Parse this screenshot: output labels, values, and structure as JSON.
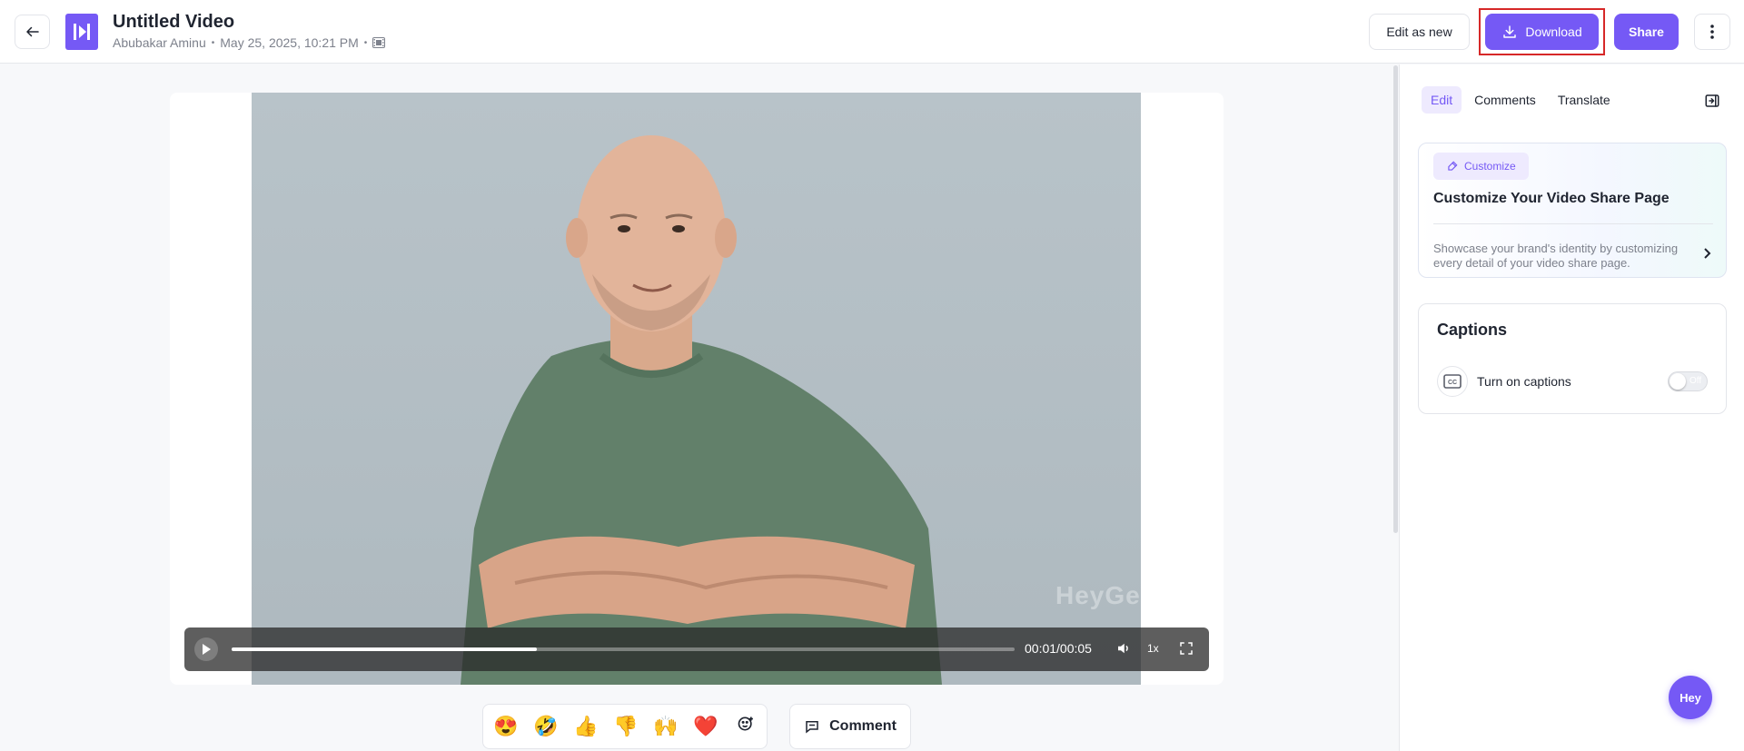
{
  "header": {
    "back_icon": "arrow-left-icon",
    "logo_icon": "heygen-logo-icon",
    "title": "Untitled Video",
    "author": "Abubakar Aminu",
    "date": "May 25, 2025, 10:21 PM",
    "meta_icon": "film-icon",
    "edit_as_new_label": "Edit as new",
    "download_label": "Download",
    "share_label": "Share",
    "more_icon": "more-vertical-icon"
  },
  "video": {
    "watermark": "HeyGen",
    "time": "00:01/00:05",
    "progress": 0.39,
    "speed": "1x"
  },
  "reactions": {
    "emojis": [
      "😍",
      "🤣",
      "👍",
      "👎",
      "🙌",
      "❤️"
    ],
    "comment_label": "Comment"
  },
  "panel": {
    "tabs": [
      "Edit",
      "Comments",
      "Translate"
    ],
    "active_tab": "Edit",
    "customize": {
      "chip_label": "Customize",
      "title": "Customize Your Video Share Page",
      "description": "Showcase your brand's identity by customizing every detail of your video share page."
    },
    "captions": {
      "title": "Captions",
      "label": "Turn on captions",
      "toggle_text": "Off",
      "enabled": false
    }
  },
  "fab_label": "Hey",
  "colors": {
    "accent": "#7559f5",
    "highlight_border": "#d62828"
  }
}
